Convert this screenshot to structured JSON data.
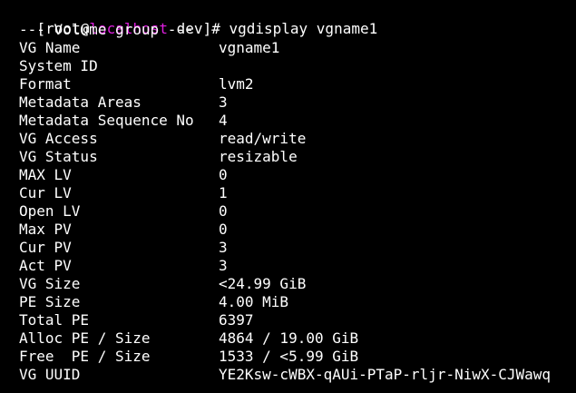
{
  "prompt": {
    "open": "[root@",
    "host": "localhost",
    "rest": " dev]# ",
    "command": "vgdisplay vgname1",
    "host_color": "#e01ee0"
  },
  "header": "--- Volume group ---",
  "rows": [
    {
      "label": "VG Name",
      "value": "vgname1"
    },
    {
      "label": "System ID",
      "value": ""
    },
    {
      "label": "Format",
      "value": "lvm2"
    },
    {
      "label": "Metadata Areas",
      "value": "3"
    },
    {
      "label": "Metadata Sequence No",
      "value": "4"
    },
    {
      "label": "VG Access",
      "value": "read/write"
    },
    {
      "label": "VG Status",
      "value": "resizable"
    },
    {
      "label": "MAX LV",
      "value": "0"
    },
    {
      "label": "Cur LV",
      "value": "1"
    },
    {
      "label": "Open LV",
      "value": "0"
    },
    {
      "label": "Max PV",
      "value": "0"
    },
    {
      "label": "Cur PV",
      "value": "3"
    },
    {
      "label": "Act PV",
      "value": "3"
    },
    {
      "label": "VG Size",
      "value": "<24.99 GiB"
    },
    {
      "label": "PE Size",
      "value": "4.00 MiB"
    },
    {
      "label": "Total PE",
      "value": "6397"
    },
    {
      "label": "Alloc PE / Size",
      "value": "4864 / 19.00 GiB"
    },
    {
      "label": "Free  PE / Size",
      "value": "1533 / <5.99 GiB"
    },
    {
      "label": "VG UUID",
      "value": "YE2Ksw-cWBX-qAUi-PTaP-rljr-NiwX-CJWawq"
    }
  ],
  "colors": {
    "background": "#000000",
    "text": "#ffffff"
  }
}
